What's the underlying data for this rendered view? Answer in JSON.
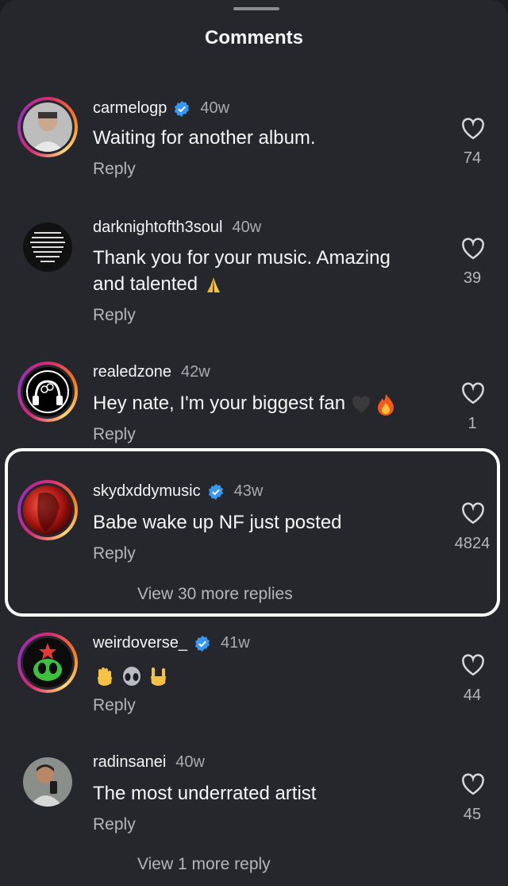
{
  "sheet": {
    "title": "Comments"
  },
  "comments": [
    {
      "username": "carmelogp",
      "verified": true,
      "age": "40w",
      "text": "Waiting for another album.",
      "reply": "Reply",
      "likes": "74"
    },
    {
      "username": "darknightofth3soul",
      "verified": false,
      "age": "40w",
      "text_line1": "Thank you for your music.  Amazing",
      "text_line2": "and talented",
      "reply": "Reply",
      "likes": "39"
    },
    {
      "username": "realedzone",
      "verified": false,
      "age": "42w",
      "text": "Hey nate, I'm your biggest fan",
      "reply": "Reply",
      "likes": "1"
    },
    {
      "username": "skydxddymusic",
      "verified": true,
      "age": "43w",
      "text": "Babe wake up NF just posted",
      "reply": "Reply",
      "likes": "4824",
      "view_replies": "View 30 more replies"
    },
    {
      "username": "weirdoverse_",
      "verified": true,
      "age": "41w",
      "reply": "Reply",
      "likes": "44"
    },
    {
      "username": "radinsanei",
      "verified": false,
      "age": "40w",
      "text": "The most underrated artist",
      "reply": "Reply",
      "likes": "45",
      "view_replies": "View 1 more reply"
    }
  ],
  "colors": {
    "background": "#26272c",
    "highlight_border": "#ffffff",
    "verified": "#3897f0"
  }
}
